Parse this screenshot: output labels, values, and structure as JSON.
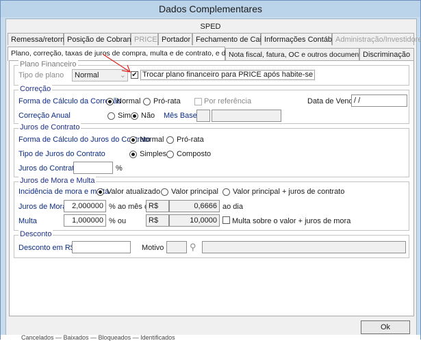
{
  "window": {
    "title": "Dados Complementares"
  },
  "tabs_top": {
    "sped": "SPED"
  },
  "tabs_row1": [
    {
      "label": "Remessa/retorno",
      "disabled": false
    },
    {
      "label": "Posição de Cobrança",
      "disabled": false
    },
    {
      "label": "PRICE",
      "disabled": true
    },
    {
      "label": "Portador",
      "disabled": false
    },
    {
      "label": "Fechamento de Caixa",
      "disabled": false
    },
    {
      "label": "Informações Contábeis",
      "disabled": false
    },
    {
      "label": "Administração/Investidores",
      "disabled": true
    }
  ],
  "tabs_row2": [
    {
      "label": "Plano, correção, taxas de juros de compra, multa e de contrato, e desconto",
      "active": true
    },
    {
      "label": "Nota fiscal, fatura, OC e outros documentos",
      "active": false
    },
    {
      "label": "Discriminação",
      "active": false
    }
  ],
  "plano": {
    "title": "Plano Financeiro",
    "tipo_label": "Tipo de plano",
    "tipo_value": "Normal",
    "trocar_label": "Trocar plano financeiro para PRICE após habite-se"
  },
  "correcao": {
    "title": "Correção",
    "forma_label": "Forma de Cálculo da Correção",
    "normal": "Normal",
    "prorata": "Pró-rata",
    "por_referencia": "Por referência",
    "data_venda_label": "Data de Venda",
    "data_venda_value": " / /",
    "anual_label": "Correção Anual",
    "sim": "Sim",
    "nao": "Não",
    "mes_base_label": "Mês Base"
  },
  "juros_contrato": {
    "title": "Juros de Contrato",
    "forma_label": "Forma de Cálculo do Juros do Contrato",
    "normal": "Normal",
    "prorata": "Pró-rata",
    "tipo_label": "Tipo de Juros do Contrato",
    "simples": "Simples",
    "composto": "Composto",
    "juros_label": "Juros do Contrato",
    "percent": "%"
  },
  "mora": {
    "title": "Juros de Mora e Multa",
    "incidencia_label": "Incidência de mora e multa",
    "valor_atualizado": "Valor atualizado",
    "valor_principal": "Valor principal",
    "valor_principal_juros": "Valor principal + juros de contrato",
    "juros_label": "Juros de Mora",
    "juros_value": "2,000000",
    "ao_mes_ou": "% ao mês ou",
    "rs": "R$",
    "juros_dia_value": "0,6666",
    "ao_dia": "ao dia",
    "multa_label": "Multa",
    "multa_value": "1,000000",
    "pct_ou": "% ou",
    "multa_rs_value": "10,0000",
    "multa_sobre_label": "Multa sobre o valor + juros de mora"
  },
  "desconto": {
    "title": "Desconto",
    "desconto_label": "Desconto em R$",
    "motivo_label": "Motivo"
  },
  "buttons": {
    "ok": "Ok"
  },
  "bottom_legend": "Cancelados  —  Baixados  —  Bloqueados  —  Identificados"
}
